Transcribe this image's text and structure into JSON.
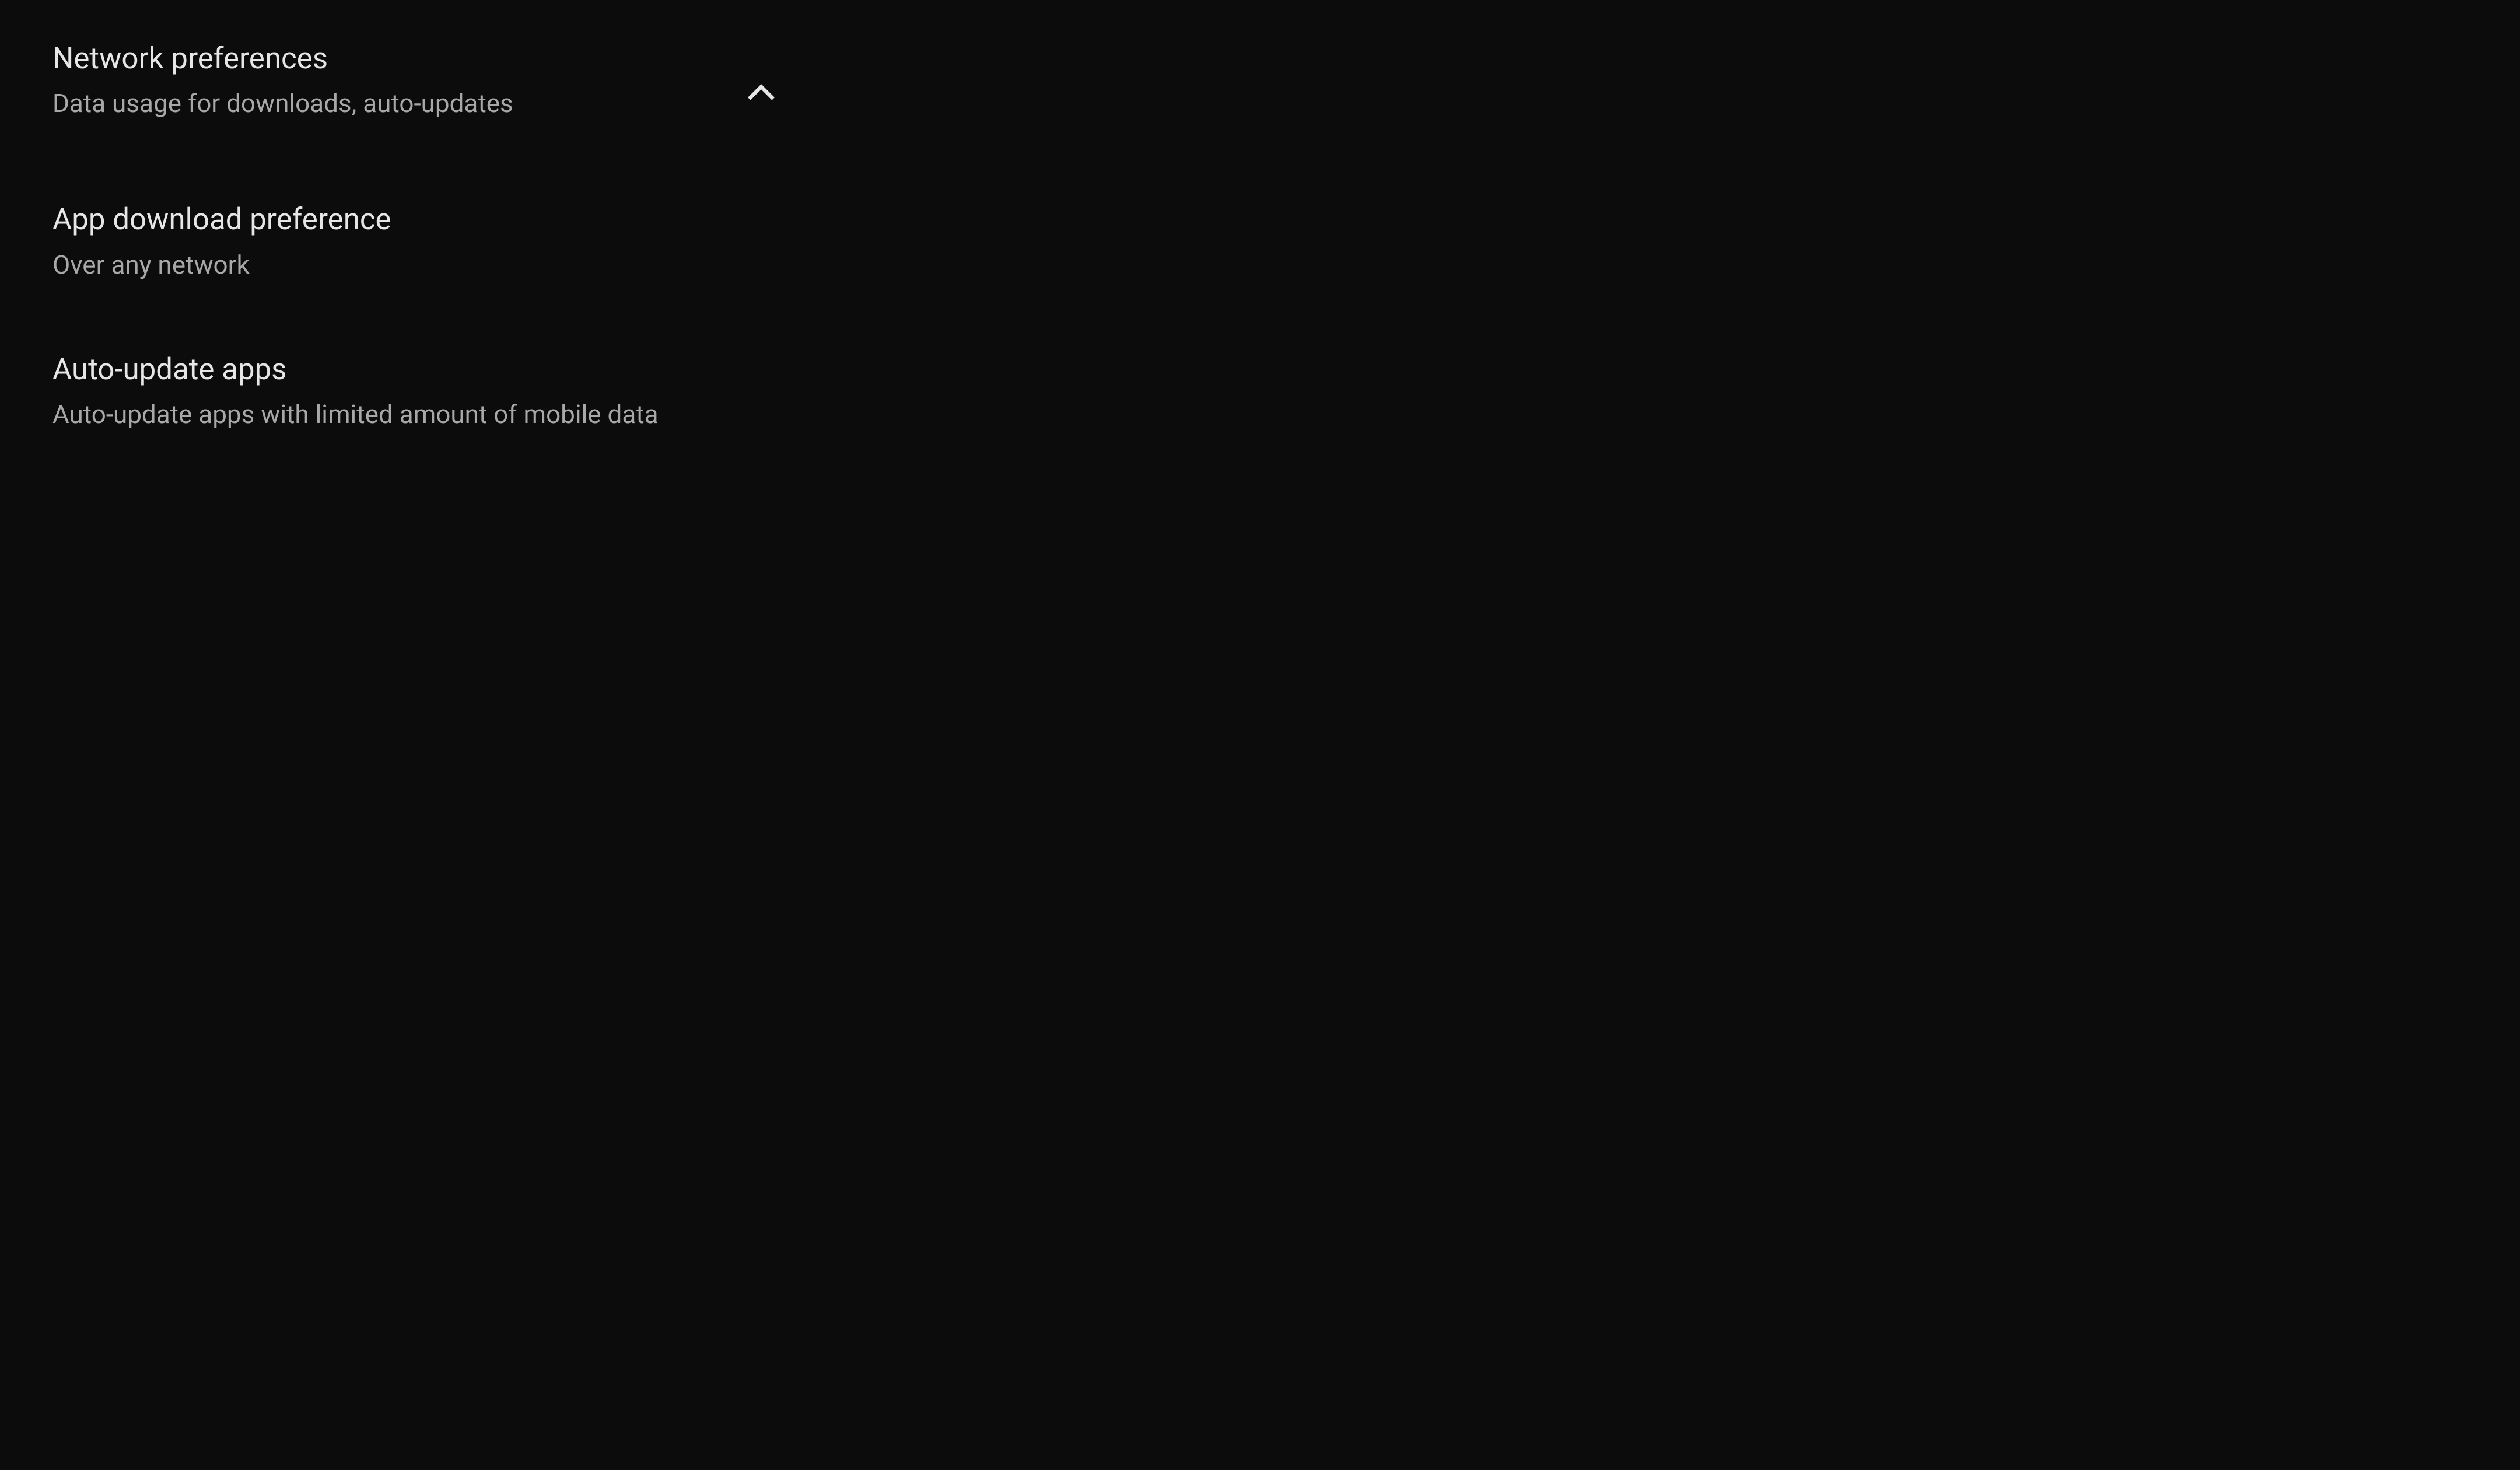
{
  "section": {
    "title": "Network preferences",
    "subtitle": "Data usage for downloads, auto-updates"
  },
  "settings": {
    "app_download": {
      "title": "App download preference",
      "value": "Over any network"
    },
    "auto_update": {
      "title": "Auto-update apps",
      "value": "Auto-update apps with limited amount of mobile data"
    }
  }
}
